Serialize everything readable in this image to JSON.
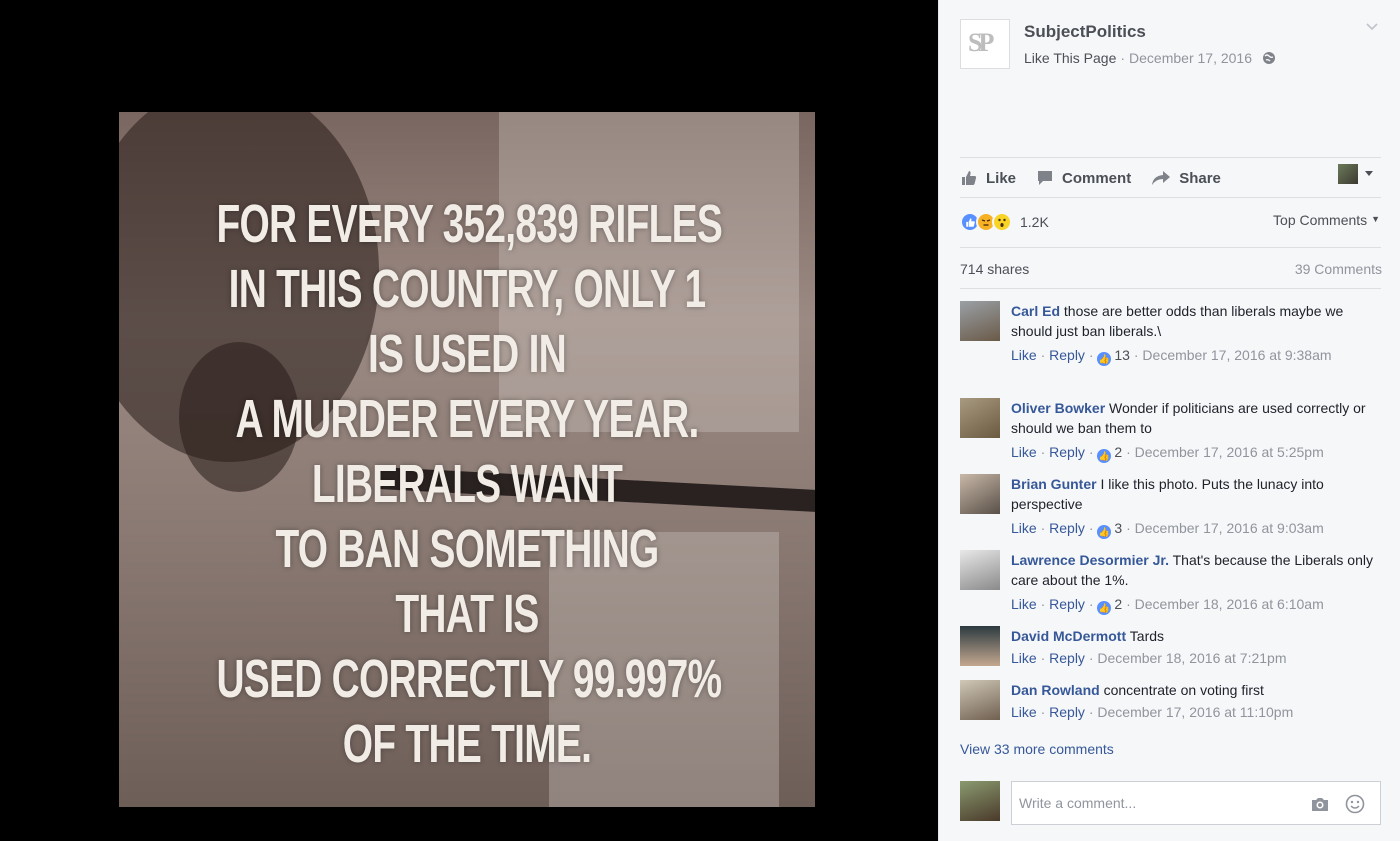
{
  "meme": {
    "lines": [
      "FOR EVERY 352,839 RIFLES",
      "IN THIS COUNTRY, ONLY 1",
      "IS USED IN",
      "A MURDER EVERY YEAR.",
      "LIBERALS WANT",
      "TO BAN SOMETHING",
      "THAT IS",
      "USED CORRECTLY 99.997%",
      "OF THE TIME."
    ]
  },
  "post": {
    "page_name": "SubjectPolitics",
    "logo_letters": "SP",
    "like_page": "Like This Page",
    "sep": "·",
    "date": "December 17, 2016",
    "privacy_icon": "globe-icon"
  },
  "actions": {
    "like": "Like",
    "comment": "Comment",
    "share": "Share"
  },
  "reactions": {
    "icons": [
      "like-reaction-icon",
      "angry-reaction-icon",
      "wow-reaction-icon"
    ],
    "count": "1.2K",
    "sort_label": "Top Comments"
  },
  "stats": {
    "shares": "714 shares",
    "comments": "39 Comments"
  },
  "comments": [
    {
      "name": "Carl Ed",
      "text": "those are better odds than liberals maybe we should just ban liberals.\\",
      "like": "Like",
      "reply": "Reply",
      "likes": "13",
      "time": "December 17, 2016 at 9:38am"
    },
    {
      "name": "Oliver Bowker",
      "text": "Wonder if politicians are used correctly or should we ban them to",
      "like": "Like",
      "reply": "Reply",
      "likes": "2",
      "time": "December 17, 2016 at 5:25pm"
    },
    {
      "name": "Brian Gunter",
      "text": "I like this photo. Puts the lunacy into perspective",
      "like": "Like",
      "reply": "Reply",
      "likes": "3",
      "time": "December 17, 2016 at 9:03am"
    },
    {
      "name": "Lawrence Desormier Jr.",
      "text": "That's because the Liberals only care about the 1%.",
      "like": "Like",
      "reply": "Reply",
      "likes": "2",
      "time": "December 18, 2016 at 6:10am"
    },
    {
      "name": "David McDermott",
      "text": "Tards",
      "like": "Like",
      "reply": "Reply",
      "likes": "",
      "time": "December 18, 2016 at 7:21pm"
    },
    {
      "name": "Dan Rowland",
      "text": "concentrate on voting first",
      "like": "Like",
      "reply": "Reply",
      "likes": "",
      "time": "December 17, 2016 at 11:10pm"
    }
  ],
  "view_more": "View 33 more comments",
  "composer": {
    "placeholder": "Write a comment..."
  },
  "colors": {
    "link": "#365899",
    "muted": "#90949c",
    "panel_bg": "#f6f7f9",
    "like_blue": "#5890ff"
  }
}
